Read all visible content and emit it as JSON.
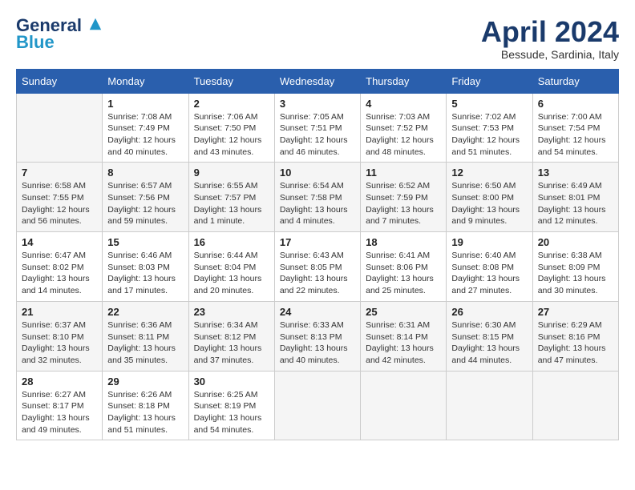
{
  "header": {
    "logo_line1": "General",
    "logo_line2": "Blue",
    "month_title": "April 2024",
    "location": "Bessude, Sardinia, Italy"
  },
  "weekdays": [
    "Sunday",
    "Monday",
    "Tuesday",
    "Wednesday",
    "Thursday",
    "Friday",
    "Saturday"
  ],
  "weeks": [
    [
      {
        "day": "",
        "sunrise": "",
        "sunset": "",
        "daylight": ""
      },
      {
        "day": "1",
        "sunrise": "Sunrise: 7:08 AM",
        "sunset": "Sunset: 7:49 PM",
        "daylight": "Daylight: 12 hours and 40 minutes."
      },
      {
        "day": "2",
        "sunrise": "Sunrise: 7:06 AM",
        "sunset": "Sunset: 7:50 PM",
        "daylight": "Daylight: 12 hours and 43 minutes."
      },
      {
        "day": "3",
        "sunrise": "Sunrise: 7:05 AM",
        "sunset": "Sunset: 7:51 PM",
        "daylight": "Daylight: 12 hours and 46 minutes."
      },
      {
        "day": "4",
        "sunrise": "Sunrise: 7:03 AM",
        "sunset": "Sunset: 7:52 PM",
        "daylight": "Daylight: 12 hours and 48 minutes."
      },
      {
        "day": "5",
        "sunrise": "Sunrise: 7:02 AM",
        "sunset": "Sunset: 7:53 PM",
        "daylight": "Daylight: 12 hours and 51 minutes."
      },
      {
        "day": "6",
        "sunrise": "Sunrise: 7:00 AM",
        "sunset": "Sunset: 7:54 PM",
        "daylight": "Daylight: 12 hours and 54 minutes."
      }
    ],
    [
      {
        "day": "7",
        "sunrise": "Sunrise: 6:58 AM",
        "sunset": "Sunset: 7:55 PM",
        "daylight": "Daylight: 12 hours and 56 minutes."
      },
      {
        "day": "8",
        "sunrise": "Sunrise: 6:57 AM",
        "sunset": "Sunset: 7:56 PM",
        "daylight": "Daylight: 12 hours and 59 minutes."
      },
      {
        "day": "9",
        "sunrise": "Sunrise: 6:55 AM",
        "sunset": "Sunset: 7:57 PM",
        "daylight": "Daylight: 13 hours and 1 minute."
      },
      {
        "day": "10",
        "sunrise": "Sunrise: 6:54 AM",
        "sunset": "Sunset: 7:58 PM",
        "daylight": "Daylight: 13 hours and 4 minutes."
      },
      {
        "day": "11",
        "sunrise": "Sunrise: 6:52 AM",
        "sunset": "Sunset: 7:59 PM",
        "daylight": "Daylight: 13 hours and 7 minutes."
      },
      {
        "day": "12",
        "sunrise": "Sunrise: 6:50 AM",
        "sunset": "Sunset: 8:00 PM",
        "daylight": "Daylight: 13 hours and 9 minutes."
      },
      {
        "day": "13",
        "sunrise": "Sunrise: 6:49 AM",
        "sunset": "Sunset: 8:01 PM",
        "daylight": "Daylight: 13 hours and 12 minutes."
      }
    ],
    [
      {
        "day": "14",
        "sunrise": "Sunrise: 6:47 AM",
        "sunset": "Sunset: 8:02 PM",
        "daylight": "Daylight: 13 hours and 14 minutes."
      },
      {
        "day": "15",
        "sunrise": "Sunrise: 6:46 AM",
        "sunset": "Sunset: 8:03 PM",
        "daylight": "Daylight: 13 hours and 17 minutes."
      },
      {
        "day": "16",
        "sunrise": "Sunrise: 6:44 AM",
        "sunset": "Sunset: 8:04 PM",
        "daylight": "Daylight: 13 hours and 20 minutes."
      },
      {
        "day": "17",
        "sunrise": "Sunrise: 6:43 AM",
        "sunset": "Sunset: 8:05 PM",
        "daylight": "Daylight: 13 hours and 22 minutes."
      },
      {
        "day": "18",
        "sunrise": "Sunrise: 6:41 AM",
        "sunset": "Sunset: 8:06 PM",
        "daylight": "Daylight: 13 hours and 25 minutes."
      },
      {
        "day": "19",
        "sunrise": "Sunrise: 6:40 AM",
        "sunset": "Sunset: 8:08 PM",
        "daylight": "Daylight: 13 hours and 27 minutes."
      },
      {
        "day": "20",
        "sunrise": "Sunrise: 6:38 AM",
        "sunset": "Sunset: 8:09 PM",
        "daylight": "Daylight: 13 hours and 30 minutes."
      }
    ],
    [
      {
        "day": "21",
        "sunrise": "Sunrise: 6:37 AM",
        "sunset": "Sunset: 8:10 PM",
        "daylight": "Daylight: 13 hours and 32 minutes."
      },
      {
        "day": "22",
        "sunrise": "Sunrise: 6:36 AM",
        "sunset": "Sunset: 8:11 PM",
        "daylight": "Daylight: 13 hours and 35 minutes."
      },
      {
        "day": "23",
        "sunrise": "Sunrise: 6:34 AM",
        "sunset": "Sunset: 8:12 PM",
        "daylight": "Daylight: 13 hours and 37 minutes."
      },
      {
        "day": "24",
        "sunrise": "Sunrise: 6:33 AM",
        "sunset": "Sunset: 8:13 PM",
        "daylight": "Daylight: 13 hours and 40 minutes."
      },
      {
        "day": "25",
        "sunrise": "Sunrise: 6:31 AM",
        "sunset": "Sunset: 8:14 PM",
        "daylight": "Daylight: 13 hours and 42 minutes."
      },
      {
        "day": "26",
        "sunrise": "Sunrise: 6:30 AM",
        "sunset": "Sunset: 8:15 PM",
        "daylight": "Daylight: 13 hours and 44 minutes."
      },
      {
        "day": "27",
        "sunrise": "Sunrise: 6:29 AM",
        "sunset": "Sunset: 8:16 PM",
        "daylight": "Daylight: 13 hours and 47 minutes."
      }
    ],
    [
      {
        "day": "28",
        "sunrise": "Sunrise: 6:27 AM",
        "sunset": "Sunset: 8:17 PM",
        "daylight": "Daylight: 13 hours and 49 minutes."
      },
      {
        "day": "29",
        "sunrise": "Sunrise: 6:26 AM",
        "sunset": "Sunset: 8:18 PM",
        "daylight": "Daylight: 13 hours and 51 minutes."
      },
      {
        "day": "30",
        "sunrise": "Sunrise: 6:25 AM",
        "sunset": "Sunset: 8:19 PM",
        "daylight": "Daylight: 13 hours and 54 minutes."
      },
      {
        "day": "",
        "sunrise": "",
        "sunset": "",
        "daylight": ""
      },
      {
        "day": "",
        "sunrise": "",
        "sunset": "",
        "daylight": ""
      },
      {
        "day": "",
        "sunrise": "",
        "sunset": "",
        "daylight": ""
      },
      {
        "day": "",
        "sunrise": "",
        "sunset": "",
        "daylight": ""
      }
    ]
  ]
}
